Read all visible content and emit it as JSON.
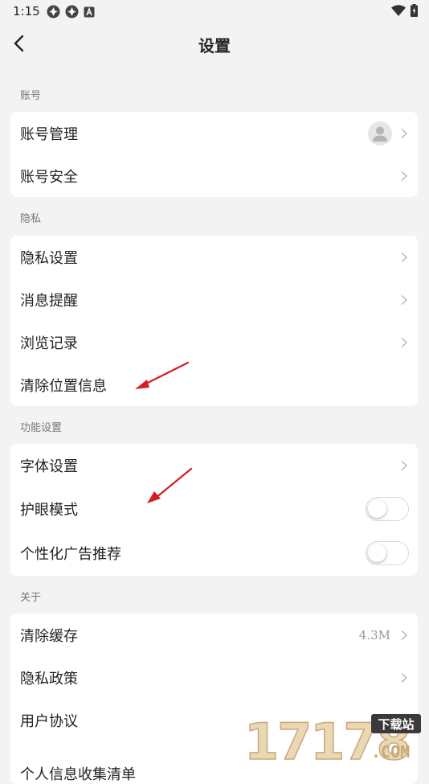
{
  "status_bar": {
    "time": "1:15",
    "left_icons": [
      "app-icon",
      "app-icon",
      "notification-a-icon"
    ],
    "right_icons": [
      "wifi-icon",
      "battery-charging-icon"
    ]
  },
  "nav": {
    "title": "设置",
    "back_icon": "chevron-left-icon"
  },
  "sections": {
    "account": {
      "title": "账号",
      "items": [
        {
          "label": "账号管理",
          "has_avatar": true
        },
        {
          "label": "账号安全"
        }
      ]
    },
    "privacy": {
      "title": "隐私",
      "items": [
        {
          "label": "隐私设置"
        },
        {
          "label": "消息提醒"
        },
        {
          "label": "浏览记录"
        },
        {
          "label": "清除位置信息"
        }
      ]
    },
    "features": {
      "title": "功能设置",
      "items": [
        {
          "label": "字体设置"
        },
        {
          "label": "护眼模式",
          "toggle_on": false
        },
        {
          "label": "个性化广告推荐",
          "toggle_on": false
        }
      ]
    },
    "about": {
      "title": "关于",
      "items": [
        {
          "label": "清除缓存",
          "value": "4.3M"
        },
        {
          "label": "隐私政策"
        },
        {
          "label": "用户协议"
        },
        {
          "label": "个人信息收集清单"
        }
      ]
    }
  },
  "watermark": {
    "number": "17178",
    "tag": "下载站",
    "suffix": ".COM"
  },
  "colors": {
    "background": "#f3f3f3",
    "card": "#ffffff",
    "annotation_arrow": "#d21f1f",
    "watermark": "#c9a87a"
  }
}
